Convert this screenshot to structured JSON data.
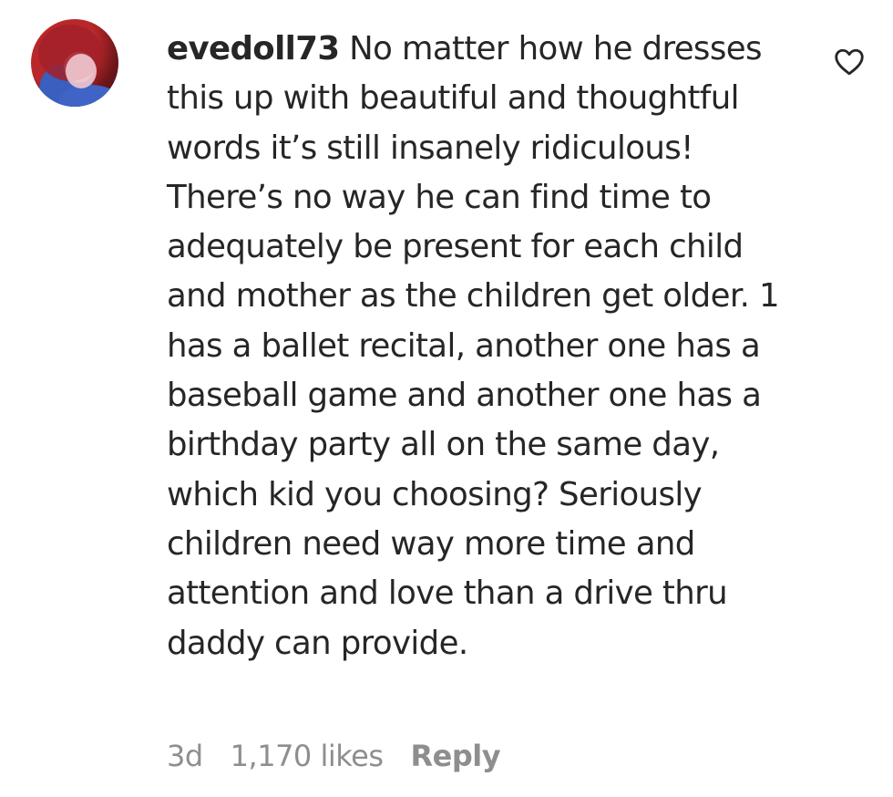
{
  "comment": {
    "username": "evedoll73",
    "text": " No matter how he dresses this up with beautiful and thoughtful words it’s still insanely ridiculous! There’s no way he can find time to adequately be present for each child and mother as the children get older. 1 has a ballet recital, another one has a baseball game and another one has a birthday party all on the same day, which kid you choosing? Seriously children need way more time and attention and love than a drive thru daddy can provide.",
    "age": "3d",
    "likes": "1,170 likes",
    "reply_label": "Reply"
  },
  "icons": {
    "like": "heart-outline-icon"
  },
  "colors": {
    "text": "#262626",
    "meta": "#8e8e8e"
  }
}
